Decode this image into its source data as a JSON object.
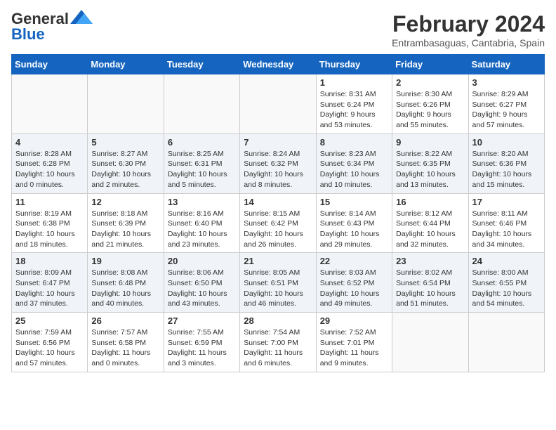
{
  "logo": {
    "line1": "General",
    "line2": "Blue"
  },
  "title": "February 2024",
  "location": "Entrambasaguas, Cantabria, Spain",
  "days_of_week": [
    "Sunday",
    "Monday",
    "Tuesday",
    "Wednesday",
    "Thursday",
    "Friday",
    "Saturday"
  ],
  "weeks": [
    [
      {
        "day": "",
        "info": ""
      },
      {
        "day": "",
        "info": ""
      },
      {
        "day": "",
        "info": ""
      },
      {
        "day": "",
        "info": ""
      },
      {
        "day": "1",
        "info": "Sunrise: 8:31 AM\nSunset: 6:24 PM\nDaylight: 9 hours and 53 minutes."
      },
      {
        "day": "2",
        "info": "Sunrise: 8:30 AM\nSunset: 6:26 PM\nDaylight: 9 hours and 55 minutes."
      },
      {
        "day": "3",
        "info": "Sunrise: 8:29 AM\nSunset: 6:27 PM\nDaylight: 9 hours and 57 minutes."
      }
    ],
    [
      {
        "day": "4",
        "info": "Sunrise: 8:28 AM\nSunset: 6:28 PM\nDaylight: 10 hours and 0 minutes."
      },
      {
        "day": "5",
        "info": "Sunrise: 8:27 AM\nSunset: 6:30 PM\nDaylight: 10 hours and 2 minutes."
      },
      {
        "day": "6",
        "info": "Sunrise: 8:25 AM\nSunset: 6:31 PM\nDaylight: 10 hours and 5 minutes."
      },
      {
        "day": "7",
        "info": "Sunrise: 8:24 AM\nSunset: 6:32 PM\nDaylight: 10 hours and 8 minutes."
      },
      {
        "day": "8",
        "info": "Sunrise: 8:23 AM\nSunset: 6:34 PM\nDaylight: 10 hours and 10 minutes."
      },
      {
        "day": "9",
        "info": "Sunrise: 8:22 AM\nSunset: 6:35 PM\nDaylight: 10 hours and 13 minutes."
      },
      {
        "day": "10",
        "info": "Sunrise: 8:20 AM\nSunset: 6:36 PM\nDaylight: 10 hours and 15 minutes."
      }
    ],
    [
      {
        "day": "11",
        "info": "Sunrise: 8:19 AM\nSunset: 6:38 PM\nDaylight: 10 hours and 18 minutes."
      },
      {
        "day": "12",
        "info": "Sunrise: 8:18 AM\nSunset: 6:39 PM\nDaylight: 10 hours and 21 minutes."
      },
      {
        "day": "13",
        "info": "Sunrise: 8:16 AM\nSunset: 6:40 PM\nDaylight: 10 hours and 23 minutes."
      },
      {
        "day": "14",
        "info": "Sunrise: 8:15 AM\nSunset: 6:42 PM\nDaylight: 10 hours and 26 minutes."
      },
      {
        "day": "15",
        "info": "Sunrise: 8:14 AM\nSunset: 6:43 PM\nDaylight: 10 hours and 29 minutes."
      },
      {
        "day": "16",
        "info": "Sunrise: 8:12 AM\nSunset: 6:44 PM\nDaylight: 10 hours and 32 minutes."
      },
      {
        "day": "17",
        "info": "Sunrise: 8:11 AM\nSunset: 6:46 PM\nDaylight: 10 hours and 34 minutes."
      }
    ],
    [
      {
        "day": "18",
        "info": "Sunrise: 8:09 AM\nSunset: 6:47 PM\nDaylight: 10 hours and 37 minutes."
      },
      {
        "day": "19",
        "info": "Sunrise: 8:08 AM\nSunset: 6:48 PM\nDaylight: 10 hours and 40 minutes."
      },
      {
        "day": "20",
        "info": "Sunrise: 8:06 AM\nSunset: 6:50 PM\nDaylight: 10 hours and 43 minutes."
      },
      {
        "day": "21",
        "info": "Sunrise: 8:05 AM\nSunset: 6:51 PM\nDaylight: 10 hours and 46 minutes."
      },
      {
        "day": "22",
        "info": "Sunrise: 8:03 AM\nSunset: 6:52 PM\nDaylight: 10 hours and 49 minutes."
      },
      {
        "day": "23",
        "info": "Sunrise: 8:02 AM\nSunset: 6:54 PM\nDaylight: 10 hours and 51 minutes."
      },
      {
        "day": "24",
        "info": "Sunrise: 8:00 AM\nSunset: 6:55 PM\nDaylight: 10 hours and 54 minutes."
      }
    ],
    [
      {
        "day": "25",
        "info": "Sunrise: 7:59 AM\nSunset: 6:56 PM\nDaylight: 10 hours and 57 minutes."
      },
      {
        "day": "26",
        "info": "Sunrise: 7:57 AM\nSunset: 6:58 PM\nDaylight: 11 hours and 0 minutes."
      },
      {
        "day": "27",
        "info": "Sunrise: 7:55 AM\nSunset: 6:59 PM\nDaylight: 11 hours and 3 minutes."
      },
      {
        "day": "28",
        "info": "Sunrise: 7:54 AM\nSunset: 7:00 PM\nDaylight: 11 hours and 6 minutes."
      },
      {
        "day": "29",
        "info": "Sunrise: 7:52 AM\nSunset: 7:01 PM\nDaylight: 11 hours and 9 minutes."
      },
      {
        "day": "",
        "info": ""
      },
      {
        "day": "",
        "info": ""
      }
    ]
  ]
}
